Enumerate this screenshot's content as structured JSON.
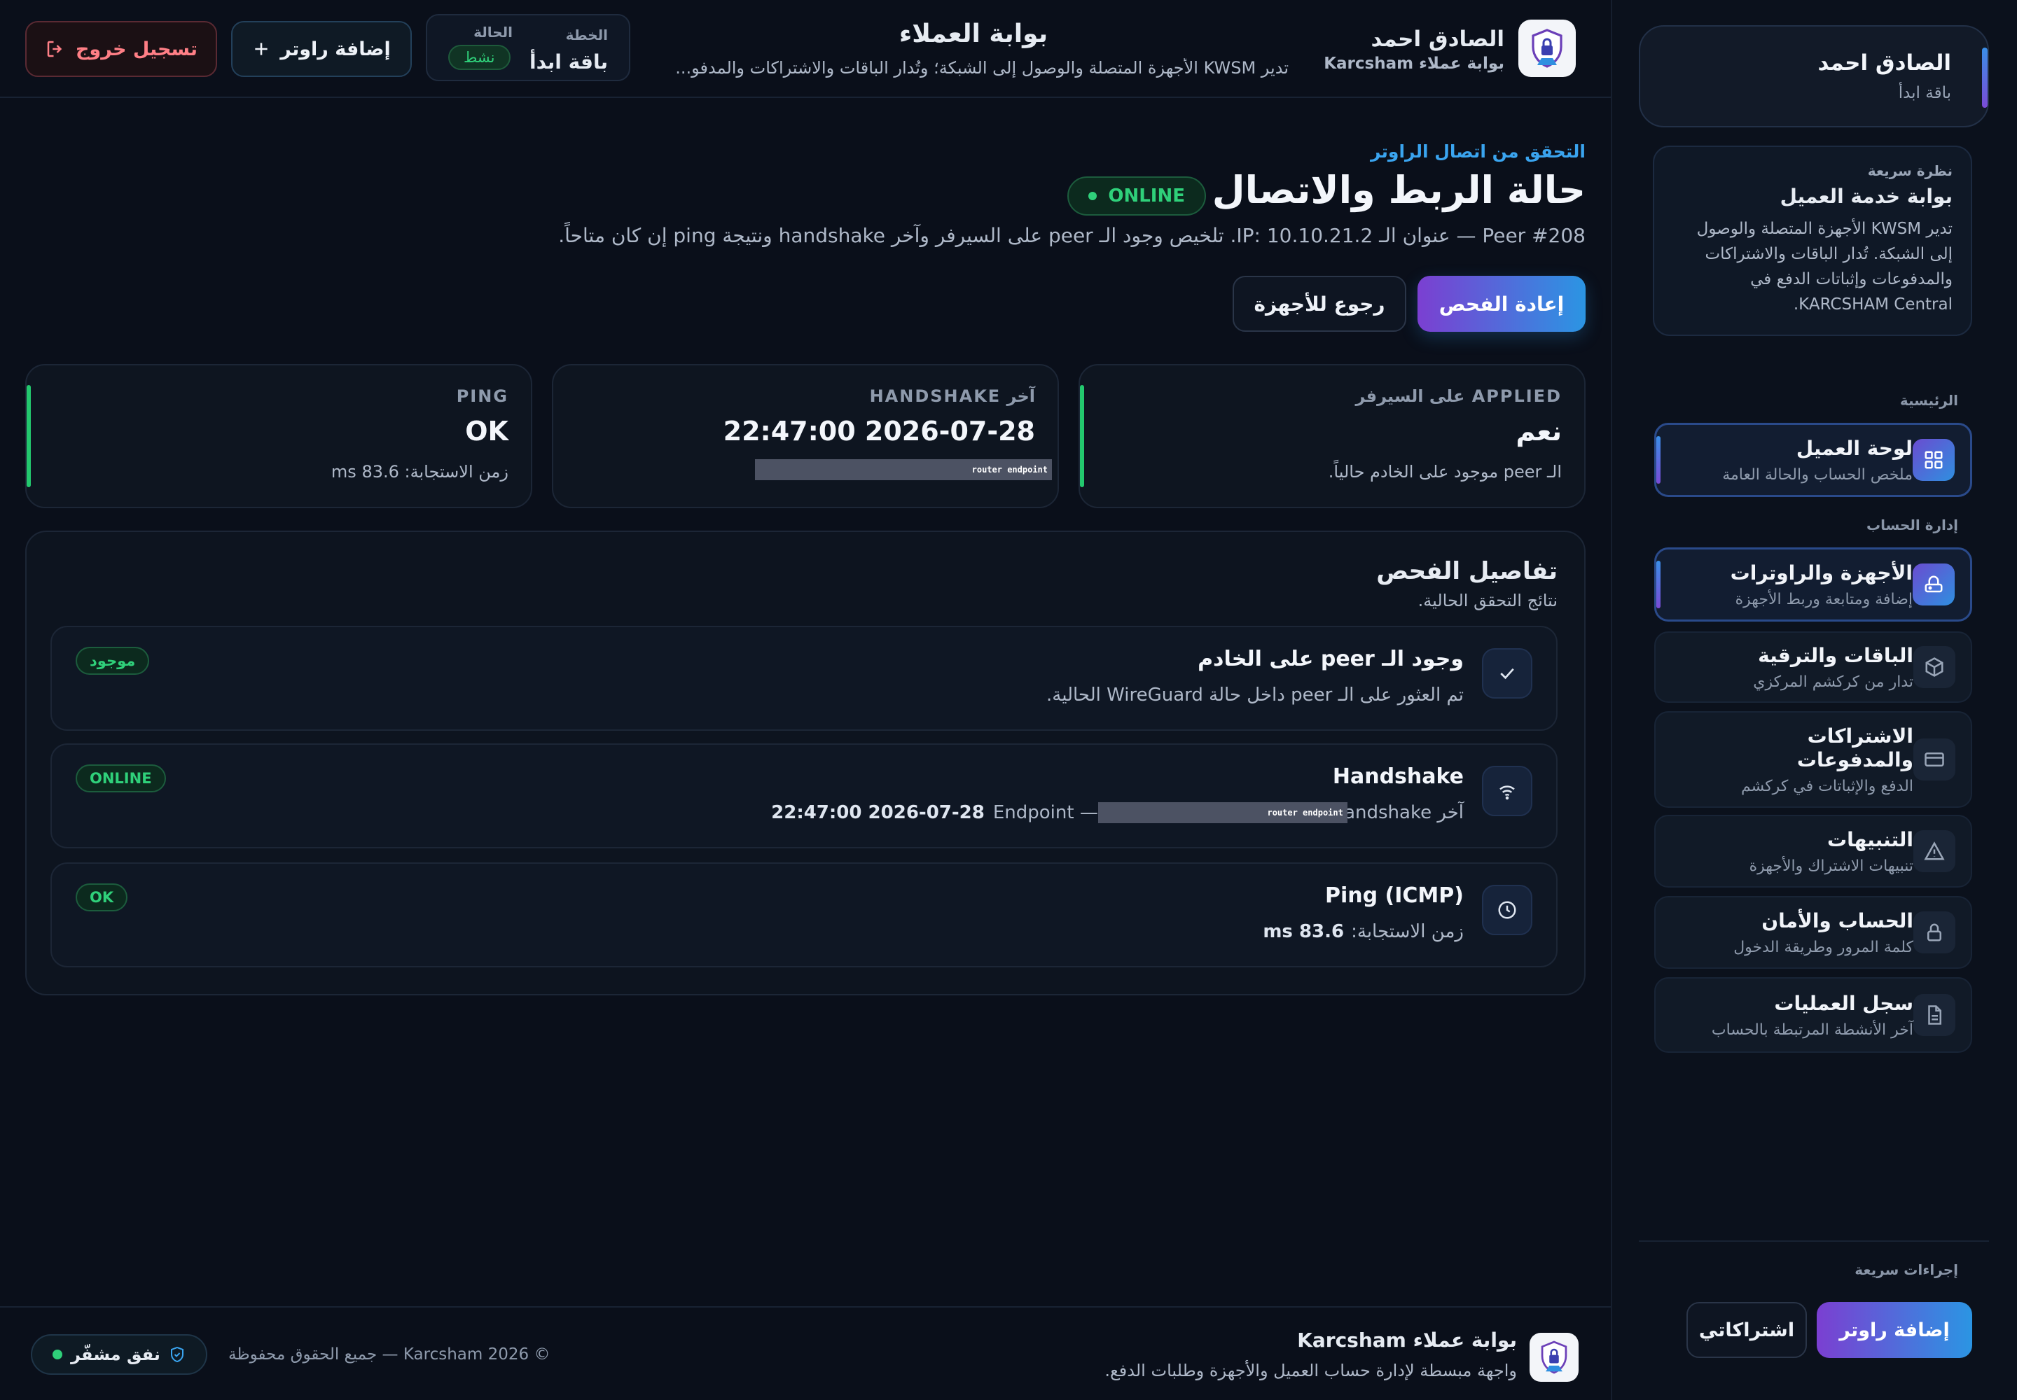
{
  "sidebar": {
    "user_name": "الصادق احمد",
    "user_plan": "باقة ابدأ",
    "overview_kicker": "نظرة سريعة",
    "overview_title": "بوابة خدمة العميل",
    "overview_desc": "تدير KWSM الأجهزة المتصلة والوصول إلى الشبكة. تُدار الباقات والاشتراكات والمدفوعات وإثباتات الدفع في KARCSHAM Central.",
    "section_main": "الرئيسية",
    "section_account": "إدارة الحساب",
    "items": [
      {
        "label": "لوحة العميل",
        "sub": "ملخص الحساب والحالة العامة",
        "icon": "dashboard-icon"
      },
      {
        "label": "الأجهزة والراوترات",
        "sub": "إضافة ومتابعة وربط الأجهزة",
        "icon": "router-icon"
      },
      {
        "label": "الباقات والترقية",
        "sub": "تدار من كركشم المركزي",
        "icon": "box-icon"
      },
      {
        "label": "الاشتراكات والمدفوعات",
        "sub": "الدفع والإثباتات في كركشم",
        "icon": "credit-card-icon"
      },
      {
        "label": "التنبيهات",
        "sub": "تنبيهات الاشتراك والأجهزة",
        "icon": "warning-icon"
      },
      {
        "label": "الحساب والأمان",
        "sub": "كلمة المرور وطريقة الدخول",
        "icon": "lock-icon"
      },
      {
        "label": "سجل العمليات",
        "sub": "آخر الأنشطة المرتبطة بالحساب",
        "icon": "document-icon"
      }
    ],
    "quick_actions_label": "إجراءات سريعة",
    "quick_add_router": "إضافة راوتر",
    "quick_subscriptions": "اشتراكاتي"
  },
  "header": {
    "brand_name": "الصادق احمد",
    "brand_sub": "بوابة عملاء Karcsham",
    "portal_title": "بوابة العملاء",
    "portal_sub": "تدير KWSM الأجهزة المتصلة والوصول إلى الشبكة؛ وتُدار الباقات والاشتراكات والمدفو...",
    "plan_label": "الخطة",
    "plan_value": "باقة ابدأ",
    "status_label": "الحالة",
    "status_value": "نشط",
    "add_router": "إضافة راوتر",
    "logout": "تسجيل خروج"
  },
  "main": {
    "kicker": "التحقق من اتصال الراوتر",
    "title": "حالة الربط والاتصال",
    "online_badge": "ONLINE",
    "description": "Peer #208 — عنوان الـ IP: 10.10.21.2. تلخيص وجود الـ peer على السيرفر وآخر handshake ونتيجة ping إن كان متاحاً.",
    "retry_button": "إعادة الفحص",
    "back_button": "رجوع للأجهزة",
    "cards": [
      {
        "label": "APPLIED على السيرفر",
        "value": "نعم",
        "sub": "الـ peer موجود على الخادم حالياً."
      },
      {
        "label": "آخر HANDSHAKE",
        "value": "2026-07-28 22:47:00",
        "redacted": "router endpoint"
      },
      {
        "label": "PING",
        "value": "OK",
        "sub": "زمن الاستجابة: 83.6 ms"
      }
    ],
    "details_title": "تفاصيل الفحص",
    "details_sub": "نتائج التحقق الحالية.",
    "checks": [
      {
        "title": "وجود الـ peer على الخادم",
        "desc": "تم العثور على الـ peer داخل حالة WireGuard الحالية.",
        "badge": "موجود",
        "icon": "check-icon"
      },
      {
        "title": "Handshake",
        "desc_prefix": "آخر handshake:",
        "desc_value": "2026-07-28 22:47:00",
        "desc_mid": "— Endpoint",
        "redacted": "router endpoint",
        "badge": "ONLINE",
        "icon": "wifi-icon"
      },
      {
        "title": "Ping (ICMP)",
        "desc_prefix": "زمن الاستجابة:",
        "desc_value": "83.6 ms",
        "badge": "OK",
        "icon": "clock-icon"
      }
    ]
  },
  "footer": {
    "brand": "بوابة عملاء Karcsham",
    "desc": "واجهة مبسطة لإدارة حساب العميل والأجهزة وطلبات الدفع.",
    "copyright": "© 2026 Karcsham — جميع الحقوق محفوظة",
    "tunnel": "نفق مشفّر"
  },
  "colors": {
    "accent_blue": "#2b95e3",
    "accent_purple": "#7b3fd1",
    "success": "#2fd07a",
    "danger": "#ff7f86",
    "background": "#0a0f1a"
  }
}
